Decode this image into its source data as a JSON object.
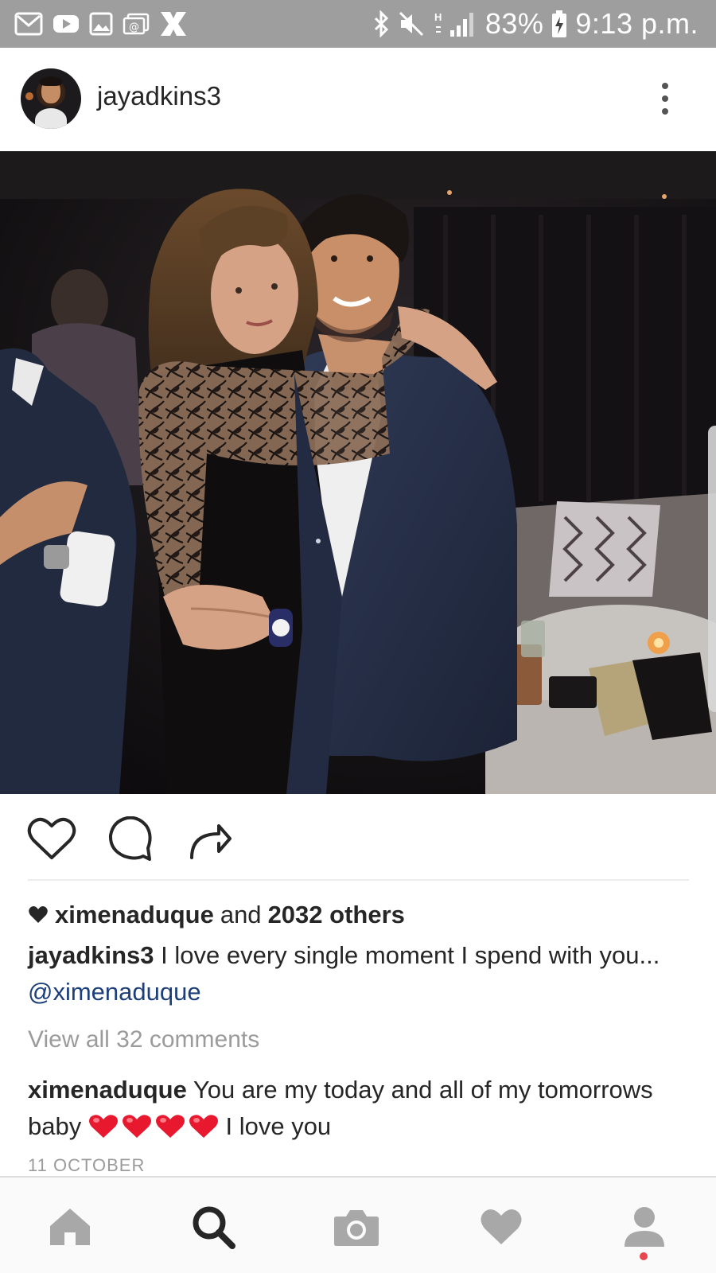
{
  "status_bar": {
    "battery": "83%",
    "time": "9:13 p.m.",
    "network_label": "H",
    "left_icons": [
      "gmail-icon",
      "youtube-icon",
      "gallery-icon",
      "email-icon",
      "x-app-icon"
    ],
    "right_icons": [
      "bluetooth-icon",
      "mute-icon",
      "signal-icon",
      "battery-charging-icon"
    ]
  },
  "post": {
    "author": "jayadkins3",
    "likes": {
      "first_liker": "ximenaduque",
      "connector": "and",
      "others": "2032 others"
    },
    "caption": {
      "author": "jayadkins3",
      "text": "I love every single moment I spend with you...",
      "mention": "@ximenaduque"
    },
    "view_all_comments": "View all 32 comments",
    "comment": {
      "author": "ximenaduque",
      "text_before": "You are my today and all of my tomorrows baby",
      "emoji": "heart-emoji x4",
      "text_after": "I love you"
    },
    "date": "11 OCTOBER"
  },
  "bottom_nav": {
    "items": [
      "home-icon",
      "search-icon",
      "camera-icon",
      "activity-heart-icon",
      "profile-icon"
    ],
    "active": "search-icon"
  }
}
